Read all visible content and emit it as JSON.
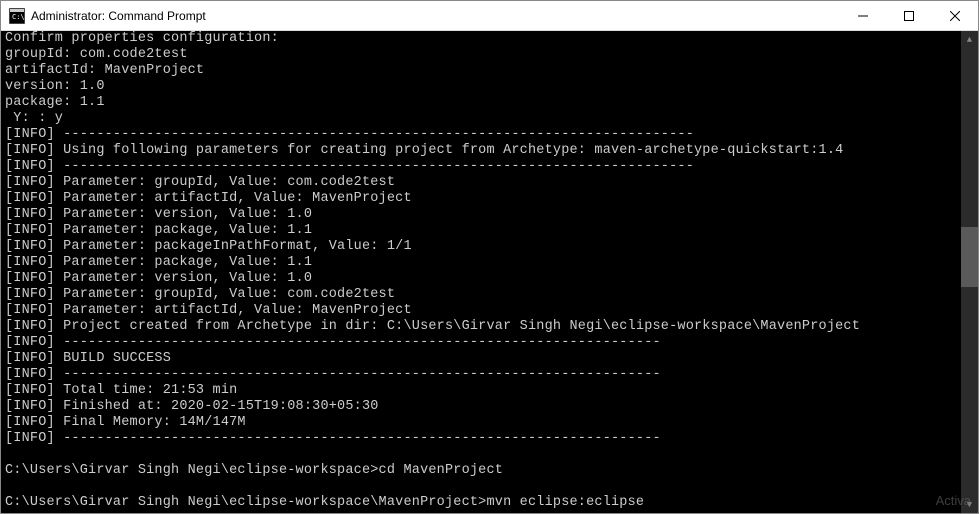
{
  "window": {
    "title": "Administrator: Command Prompt"
  },
  "terminal": {
    "lines": [
      "Confirm properties configuration:",
      "groupId: com.code2test",
      "artifactId: MavenProject",
      "version: 1.0",
      "package: 1.1",
      " Y: : y",
      "[INFO] ----------------------------------------------------------------------------",
      "[INFO] Using following parameters for creating project from Archetype: maven-archetype-quickstart:1.4",
      "[INFO] ----------------------------------------------------------------------------",
      "[INFO] Parameter: groupId, Value: com.code2test",
      "[INFO] Parameter: artifactId, Value: MavenProject",
      "[INFO] Parameter: version, Value: 1.0",
      "[INFO] Parameter: package, Value: 1.1",
      "[INFO] Parameter: packageInPathFormat, Value: 1/1",
      "[INFO] Parameter: package, Value: 1.1",
      "[INFO] Parameter: version, Value: 1.0",
      "[INFO] Parameter: groupId, Value: com.code2test",
      "[INFO] Parameter: artifactId, Value: MavenProject",
      "[INFO] Project created from Archetype in dir: C:\\Users\\Girvar Singh Negi\\eclipse-workspace\\MavenProject",
      "[INFO] ------------------------------------------------------------------------",
      "[INFO] BUILD SUCCESS",
      "[INFO] ------------------------------------------------------------------------",
      "[INFO] Total time: 21:53 min",
      "[INFO] Finished at: 2020-02-15T19:08:30+05:30",
      "[INFO] Final Memory: 14M/147M",
      "[INFO] ------------------------------------------------------------------------",
      "",
      "C:\\Users\\Girvar Singh Negi\\eclipse-workspace>cd MavenProject",
      "",
      "C:\\Users\\Girvar Singh Negi\\eclipse-workspace\\MavenProject>mvn eclipse:eclipse"
    ]
  },
  "watermark": "Activa"
}
